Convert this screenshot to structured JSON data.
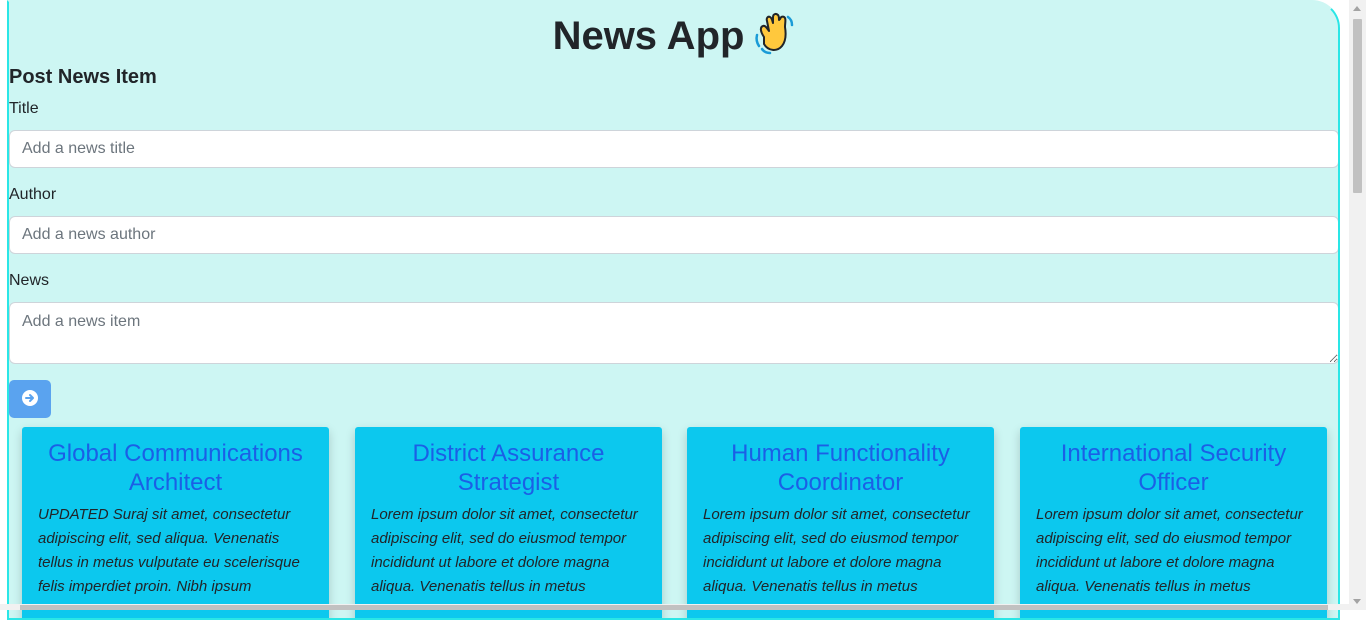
{
  "app": {
    "title": "News App"
  },
  "form": {
    "heading": "Post News Item",
    "title_label": "Title",
    "title_placeholder": "Add a news title",
    "author_label": "Author",
    "author_placeholder": "Add a news author",
    "news_label": "News",
    "news_placeholder": "Add a news item",
    "submit_icon": "arrow-circle-right-icon"
  },
  "cards": [
    {
      "title": "Global Communications Architect",
      "text": "UPDATED Suraj sit amet, consectetur adipiscing elit, sed aliqua. Venenatis tellus in metus vulputate eu scelerisque felis imperdiet proin. Nibh ipsum"
    },
    {
      "title": "District Assurance Strategist",
      "text": "Lorem ipsum dolor sit amet, consectetur adipiscing elit, sed do eiusmod tempor incididunt ut labore et dolore magna aliqua. Venenatis tellus in metus"
    },
    {
      "title": "Human Functionality Coordinator",
      "text": "Lorem ipsum dolor sit amet, consectetur adipiscing elit, sed do eiusmod tempor incididunt ut labore et dolore magna aliqua. Venenatis tellus in metus"
    },
    {
      "title": "International Security Officer",
      "text": "Lorem ipsum dolor sit amet, consectetur adipiscing elit, sed do eiusmod tempor incididunt ut labore et dolore magna aliqua. Venenatis tellus in metus"
    }
  ],
  "colors": {
    "background": "#cdf6f3",
    "card": "#0cc8ee",
    "card_title": "#1b5fe6",
    "button": "#5aa3ef"
  }
}
